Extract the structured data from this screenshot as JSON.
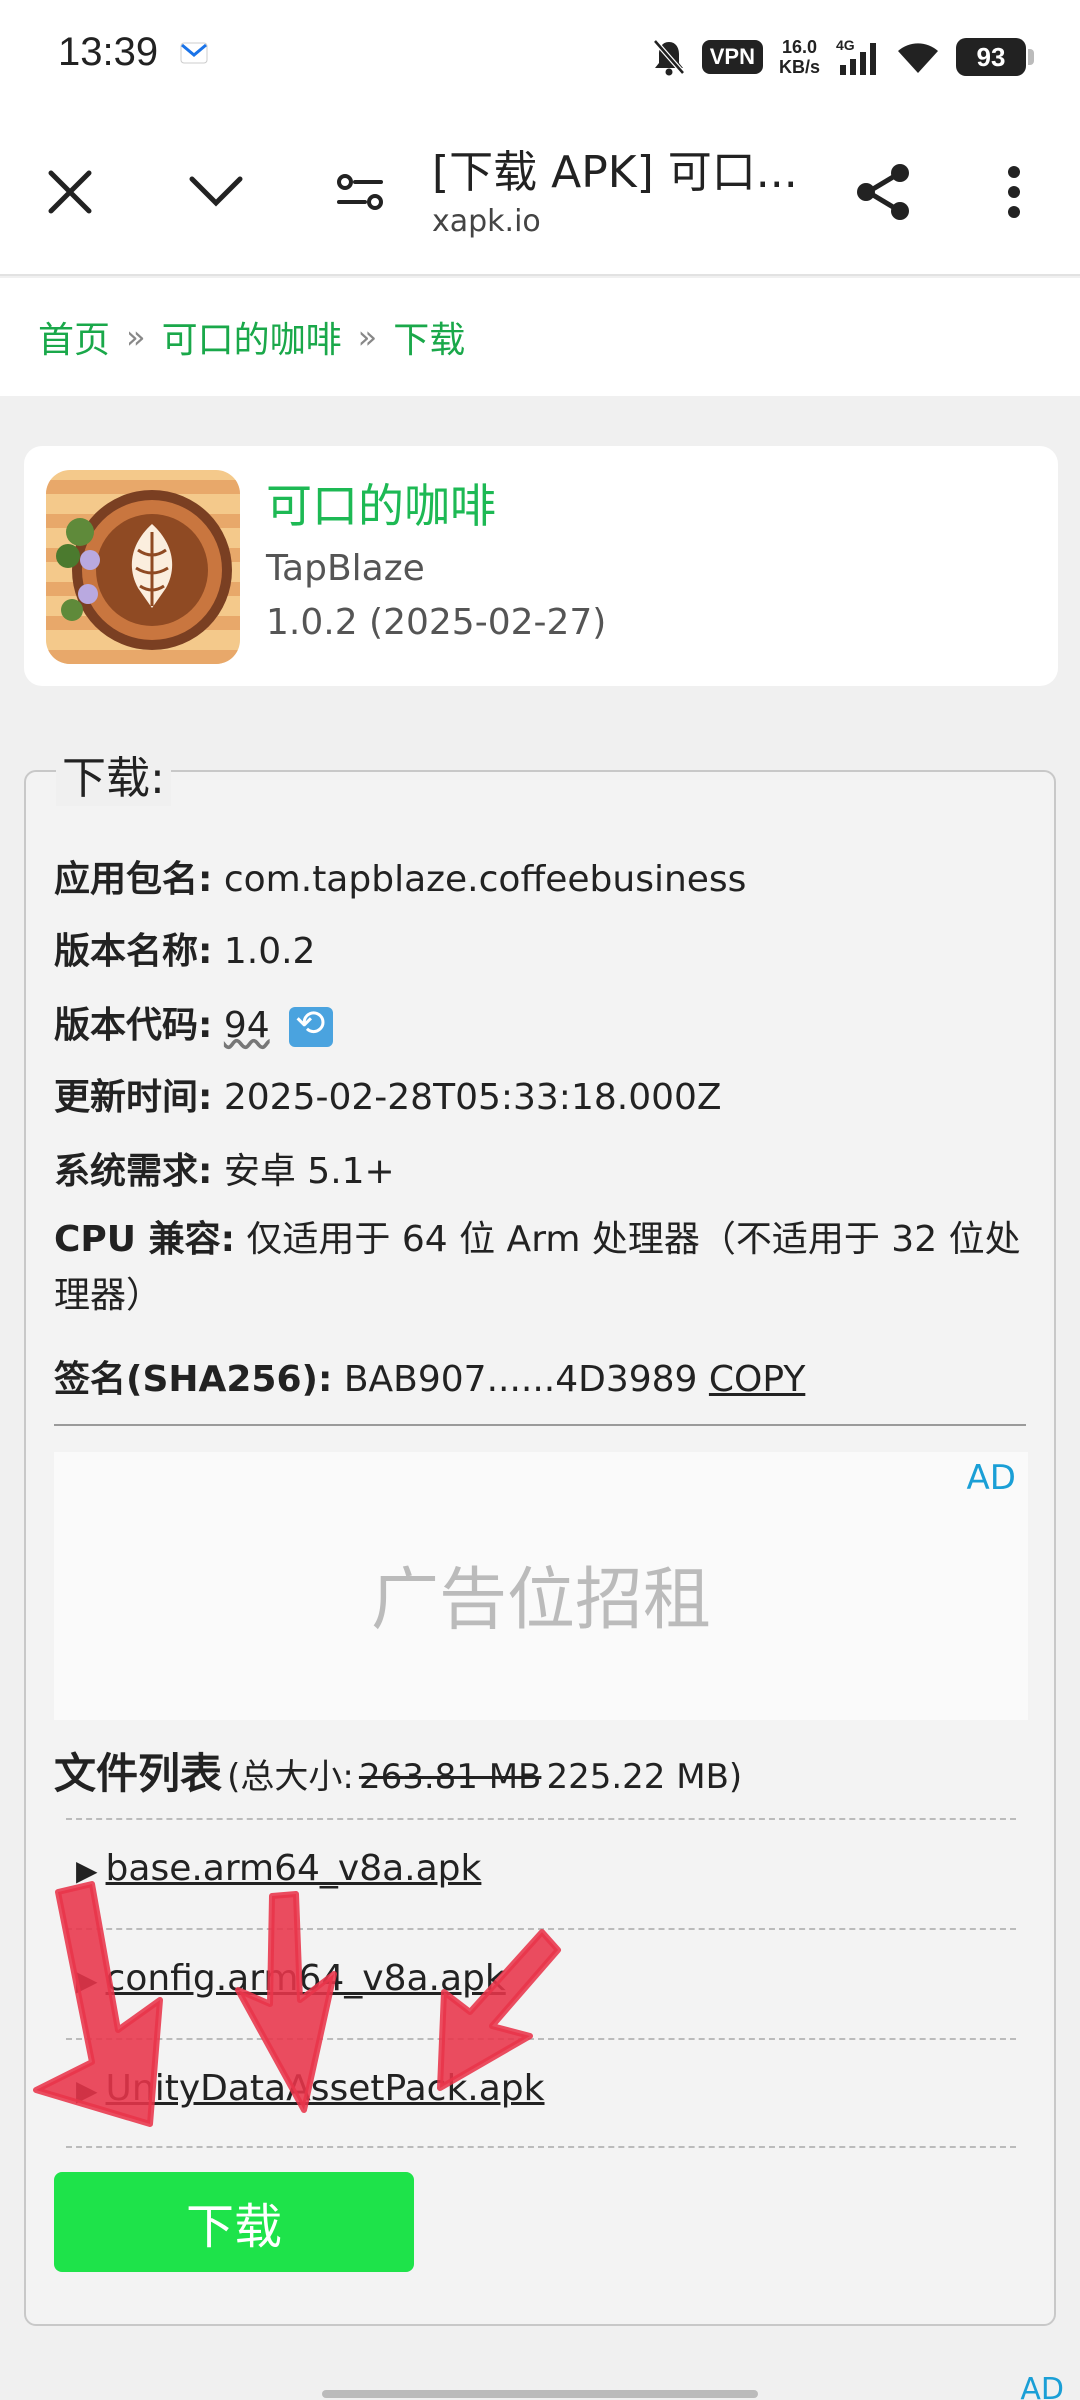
{
  "status": {
    "time": "13:39",
    "vpn": "VPN",
    "speed_value": "16.0",
    "speed_unit": "KB/s",
    "network": "4G",
    "battery": "93"
  },
  "toolbar": {
    "title": "[下载 APK] 可口...",
    "url": "xapk.io"
  },
  "breadcrumb": {
    "items": [
      "首页",
      "可口的咖啡",
      "下载"
    ],
    "separator": "»"
  },
  "app": {
    "name": "可口的咖啡",
    "developer": "TapBlaze",
    "version": "1.0.2 (2025-02-27)"
  },
  "download": {
    "legend": "下载:",
    "package_label": "应用包名:",
    "package_value": "com.tapblaze.coffeebusiness",
    "version_name_label": "版本名称:",
    "version_name_value": "1.0.2",
    "version_code_label": "版本代码:",
    "version_code_value": "94",
    "updated_label": "更新时间:",
    "updated_value": "2025-02-28T05:33:18.000Z",
    "requirement_label": "系统需求:",
    "requirement_value": "安卓 5.1+",
    "cpu_label": "CPU 兼容:",
    "cpu_value": "仅适用于 64 位 Arm 处理器（不适用于 32 位处理器）",
    "signature_label": "签名(SHA256):",
    "signature_value": "BAB907......4D3989",
    "copy_label": "COPY"
  },
  "ad": {
    "label": "AD",
    "text": "广告位招租"
  },
  "files": {
    "title": "文件列表",
    "total_prefix": "(总大小:",
    "old_size": "263.81 MB",
    "new_size": "225.22 MB)",
    "items": [
      "base.arm64_v8a.apk",
      "config.arm64_v8a.apk",
      "UnityDataAssetPack.apk"
    ]
  },
  "download_button": "下载",
  "footer_ad": "AD",
  "colors": {
    "accent_green": "#1db954",
    "button_green": "#1ee34a",
    "ad_blue": "#1a9fd6",
    "annotation_red": "#e8344a"
  }
}
